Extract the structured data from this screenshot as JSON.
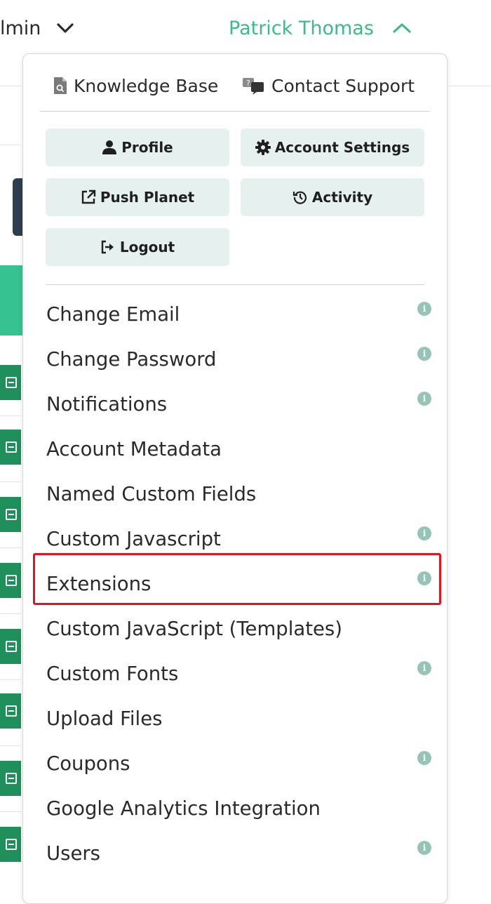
{
  "topbar": {
    "admin_label": "lmin",
    "user_name": "Patrick Thomas"
  },
  "help_links": {
    "knowledge_base": "Knowledge Base",
    "contact_support": "Contact Support"
  },
  "quick_actions": {
    "profile": "Profile",
    "account_settings": "Account Settings",
    "push_planet": "Push Planet",
    "activity": "Activity",
    "logout": "Logout"
  },
  "menu_items": [
    {
      "label": "Change Email",
      "has_info": true
    },
    {
      "label": "Change Password",
      "has_info": true
    },
    {
      "label": "Notifications",
      "has_info": true
    },
    {
      "label": "Account Metadata",
      "has_info": false
    },
    {
      "label": "Named Custom Fields",
      "has_info": false
    },
    {
      "label": "Custom Javascript",
      "has_info": true
    },
    {
      "label": "Extensions",
      "has_info": true,
      "highlighted": true
    },
    {
      "label": "Custom JavaScript (Templates)",
      "has_info": false
    },
    {
      "label": "Custom Fonts",
      "has_info": true
    },
    {
      "label": "Upload Files",
      "has_info": false
    },
    {
      "label": "Coupons",
      "has_info": true
    },
    {
      "label": "Google Analytics Integration",
      "has_info": false
    },
    {
      "label": "Users",
      "has_info": true
    }
  ],
  "info_glyph": "i",
  "colors": {
    "accent_green": "#3dba8a",
    "button_bg": "#e6f0ef",
    "info_icon": "#96c5b8",
    "highlight_red": "#e0161e"
  }
}
